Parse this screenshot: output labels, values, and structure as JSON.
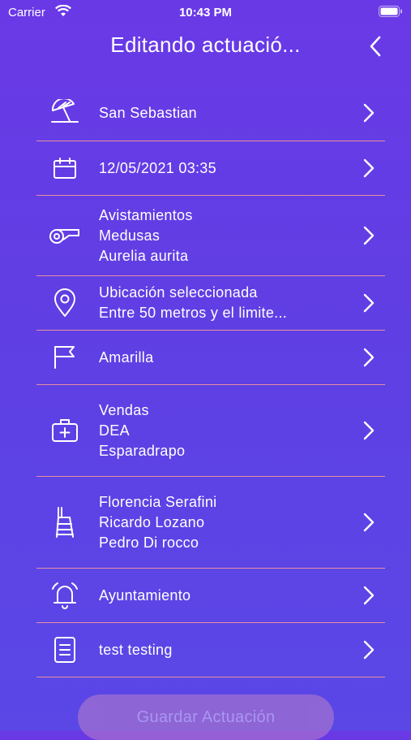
{
  "status": {
    "carrier": "Carrier",
    "time": "10:43 PM"
  },
  "nav": {
    "title": "Editando actuació..."
  },
  "rows": [
    {
      "icon": "beach-umbrella-icon",
      "lines": [
        "San Sebastian"
      ]
    },
    {
      "icon": "calendar-icon",
      "lines": [
        "12/05/2021 03:35"
      ]
    },
    {
      "icon": "whistle-icon",
      "lines": [
        "Avistamientos",
        "Medusas",
        "Aurelia aurita"
      ]
    },
    {
      "icon": "location-pin-icon",
      "lines": [
        "Ubicación seleccionada",
        "Entre 50 metros y el limite..."
      ]
    },
    {
      "icon": "flag-icon",
      "lines": [
        "Amarilla"
      ]
    },
    {
      "icon": "first-aid-kit-icon",
      "lines": [
        "Vendas",
        "DEA",
        "Esparadrapo"
      ]
    },
    {
      "icon": "lifeguard-chair-icon",
      "lines": [
        "Florencia Serafini",
        "Ricardo Lozano",
        "Pedro Di rocco"
      ]
    },
    {
      "icon": "alarm-bell-icon",
      "lines": [
        "Ayuntamiento"
      ]
    },
    {
      "icon": "notes-icon",
      "lines": [
        "test testing"
      ]
    }
  ],
  "save_button": {
    "label": "Guardar Actuación"
  },
  "colors": {
    "divider": "#e78fa0",
    "button": "#b97fc8"
  }
}
